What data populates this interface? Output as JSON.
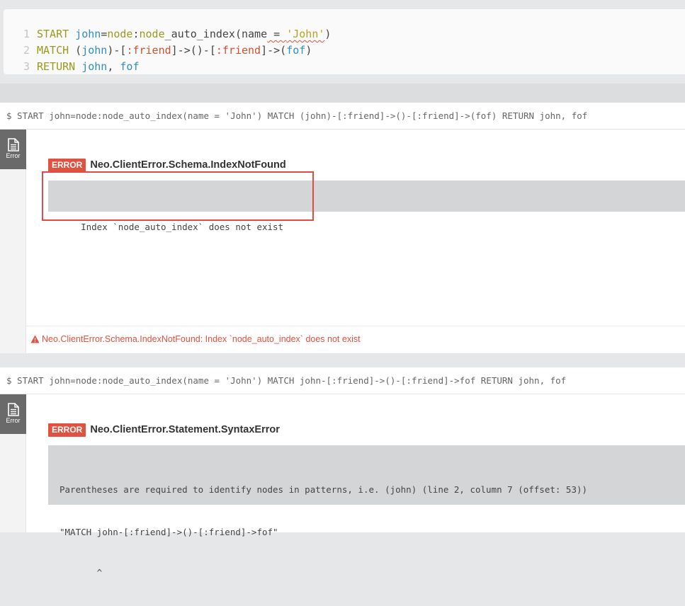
{
  "editor": {
    "line_numbers": [
      "1",
      "2",
      "3"
    ],
    "line1": {
      "kw": "START",
      "sp": " ",
      "var": "john",
      "eq": "=",
      "node": "node",
      "colon": ":",
      "node2": "node",
      "rest": "_auto_index(name",
      "sq": " = ",
      "str": "'John'",
      "close": ")"
    },
    "line2": {
      "kw": "MATCH",
      "p1": " (",
      "v1": "john",
      "p2": ")-[",
      "l1": ":friend",
      "p3": "]->()-[",
      "l2": ":friend",
      "p4": "]->(",
      "v2": "fof",
      "p5": ")"
    },
    "line3": {
      "kw": "RETURN",
      "p1": " ",
      "v1": "john",
      "p2": ", ",
      "v2": "fof"
    }
  },
  "frames": [
    {
      "command": "$ START john=node:node_auto_index(name = 'John') MATCH (john)-[:friend]->()-[:friend]->(fof) RETURN john, fof",
      "side_tab_label": "Error",
      "error_badge": "ERROR",
      "error_code": "Neo.ClientError.Schema.IndexNotFound",
      "error_message": "Index `node_auto_index` does not exist",
      "status_text": "Neo.ClientError.Schema.IndexNotFound: Index `node_auto_index` does not exist"
    },
    {
      "command": "$ START john=node:node_auto_index(name = 'John') MATCH john-[:friend]->()-[:friend]->fof RETURN john, fof",
      "side_tab_label": "Error",
      "error_badge": "ERROR",
      "error_code": "Neo.ClientError.Statement.SyntaxError",
      "error_message_lines": [
        "Parentheses are required to identify nodes in patterns, i.e. (john) (line 2, column 7 (offset: 53))",
        "\"MATCH john-[:friend]->()-[:friend]->fof\"",
        "       ^"
      ]
    }
  ],
  "colors": {
    "error": "#e0513f",
    "keyword": "#9a9a1e",
    "variable": "#2f8ec4",
    "label": "#d3502d",
    "string": "#b9a21d",
    "highlight": "#e24a45"
  },
  "icons": [
    "document-icon",
    "warning-icon"
  ]
}
